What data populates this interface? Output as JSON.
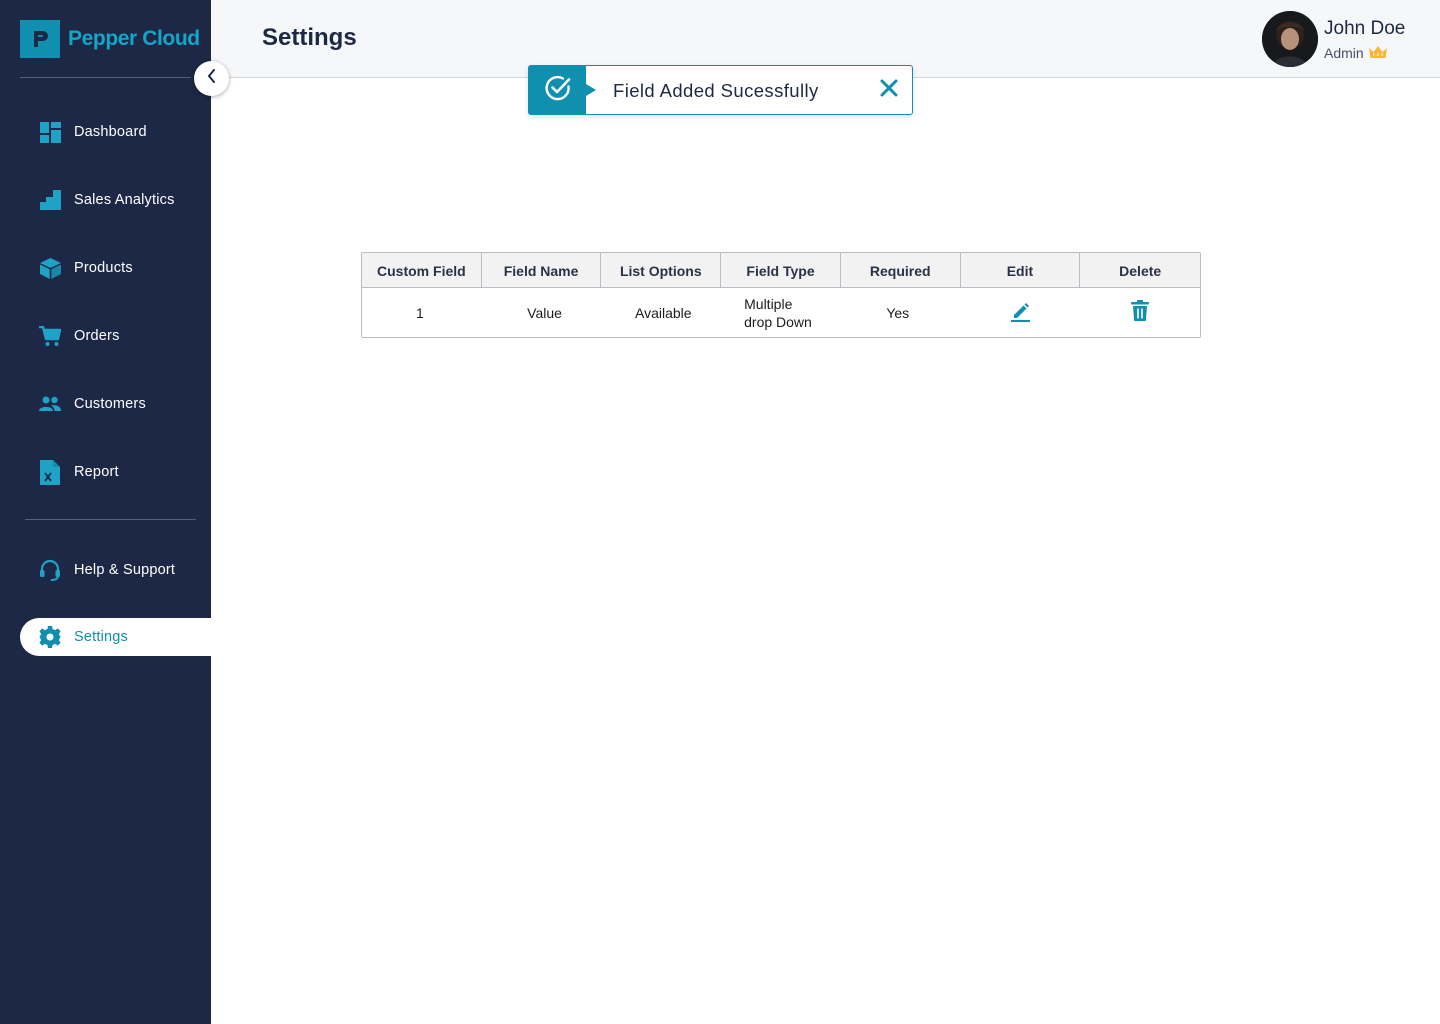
{
  "brand": {
    "name": "Pepper Cloud"
  },
  "sidebar": {
    "items": [
      {
        "label": "Dashboard",
        "icon": "dashboard-icon"
      },
      {
        "label": "Sales Analytics",
        "icon": "sales-analytics-icon"
      },
      {
        "label": "Products",
        "icon": "box-icon"
      },
      {
        "label": "Orders",
        "icon": "cart-icon"
      },
      {
        "label": "Customers",
        "icon": "users-icon"
      },
      {
        "label": "Report",
        "icon": "excel-file-icon"
      },
      {
        "label": "Help & Support",
        "icon": "headset-icon"
      },
      {
        "label": "Settings",
        "icon": "gear-icon",
        "active": true
      }
    ]
  },
  "header": {
    "title": "Settings",
    "user": {
      "name": "John Doe",
      "role": "Admin"
    }
  },
  "toast": {
    "message": "Field Added Sucessfully"
  },
  "table": {
    "columns": [
      "Custom Field",
      "Field Name",
      "List Options",
      "Field Type",
      "Required",
      "Edit",
      "Delete"
    ],
    "rows": [
      {
        "custom_field": "1",
        "field_name": "Value",
        "list_options": "Available",
        "field_type": "Multiple drop Down",
        "required": "Yes"
      }
    ]
  },
  "colors": {
    "sidebar_bg": "#1c2846",
    "accent": "#118fae",
    "header_bg": "#f6f7f9",
    "crown": "#f5b83d"
  }
}
